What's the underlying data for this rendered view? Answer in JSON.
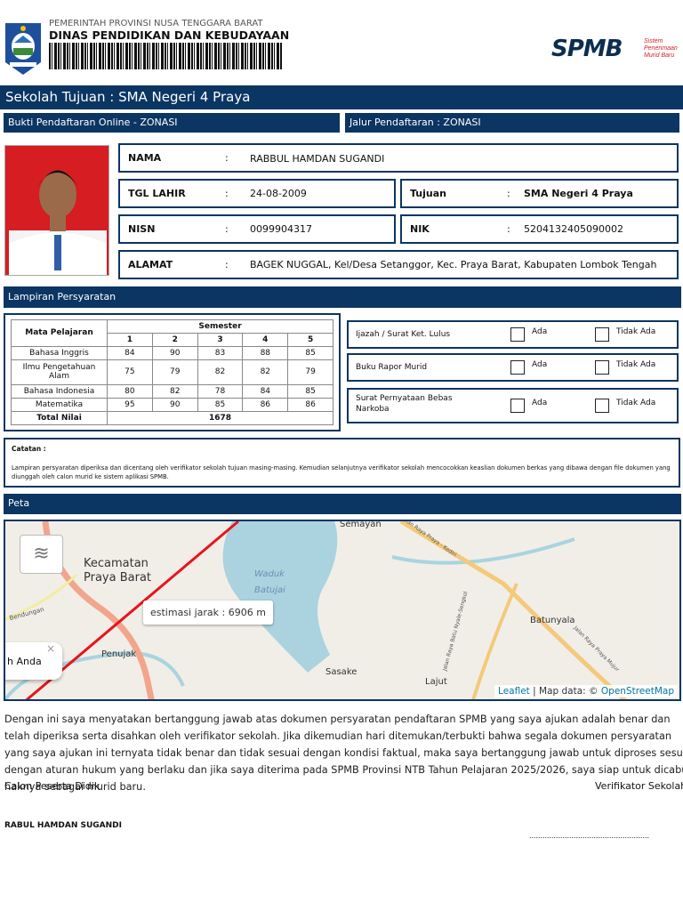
{
  "header": {
    "gov": "PEMERINTAH PROVINSI NUSA TENGGARA BARAT",
    "dept": "DINAS PENDIDIKAN DAN KEBUDAYAAN",
    "logo_text": "SPMB",
    "logo_sub": [
      "Sistem",
      "Penerimaan",
      "Murid Baru"
    ]
  },
  "title": "Sekolah Tujuan : SMA Negeri 4 Praya",
  "subbar": {
    "left": "Bukti Pendaftaran Online - ZONASI",
    "right": "Jalur Pendaftaran : ZONASI"
  },
  "info": {
    "nama": {
      "label": "NAMA",
      "value": "RABBUL HAMDAN SUGANDI"
    },
    "tgl": {
      "label": "TGL LAHIR",
      "value": "24-08-2009"
    },
    "tujuan": {
      "label": "Tujuan",
      "value": "SMA Negeri 4 Praya"
    },
    "nisn": {
      "label": "NISN",
      "value": "0099904317"
    },
    "nik": {
      "label": "NIK",
      "value": "5204132405090002"
    },
    "alamat": {
      "label": "ALAMAT",
      "value": "BAGEK NUGGAL, Kel/Desa Setanggor, Kec. Praya Barat, Kabupaten Lombok Tengah"
    },
    "colon": ":"
  },
  "lampiran": {
    "title": "Lampiran Persyaratan",
    "table": {
      "subject_header": "Mata Pelajaran",
      "semester_header": "Semester",
      "semesters": [
        "1",
        "2",
        "3",
        "4",
        "5"
      ],
      "rows": [
        {
          "subject": "Bahasa Inggris",
          "scores": [
            "84",
            "90",
            "83",
            "88",
            "85"
          ]
        },
        {
          "subject": "Ilmu Pengetahuan Alam",
          "scores": [
            "75",
            "79",
            "82",
            "82",
            "79"
          ]
        },
        {
          "subject": "Bahasa Indonesia",
          "scores": [
            "80",
            "82",
            "78",
            "84",
            "85"
          ]
        },
        {
          "subject": "Matematika",
          "scores": [
            "95",
            "90",
            "85",
            "86",
            "86"
          ]
        }
      ],
      "total_label": "Total Nilai",
      "total": "1678"
    },
    "checks": [
      {
        "label": "Ijazah / Surat Ket. Lulus"
      },
      {
        "label": "Buku Rapor Murid"
      },
      {
        "label": "Surat Pernyataan Bebas Narkoba"
      }
    ],
    "ada": "Ada",
    "tidak_ada": "Tidak Ada"
  },
  "catatan": {
    "title": "Catatan :",
    "text": "Lampiran persyaratan diperiksa dan dicentang oleh verifikator sekolah tujuan masing-masing. Kemudian selanjutnya verifikator sekolah mencocokkan keaslian dokumen berkas yang dibawa dengan file dokumen yang diunggah oleh calon murid ke sistem aplikasi SPMB."
  },
  "peta": {
    "title": "Peta",
    "labels": {
      "kecamatan": "Kecamatan",
      "praya_barat": "Praya Barat",
      "waduk": "Waduk",
      "batujai": "Batujai",
      "semayan": "Semayan",
      "penujak": "Penujak",
      "sasake": "Sasake",
      "lajut": "Lajut",
      "batunyala": "Batunyala",
      "bendungan": "Bendungan",
      "road1": "Jalan Raya Praya - Kediri",
      "road2": "Jalan Raya Batu Nyale-Sengkol",
      "road3": "Jalan Raya Praya Mujur"
    },
    "tooltip": "estimasi jarak : 6906 m",
    "popup": "h Anda",
    "popup_close": "×",
    "attr_leaflet": "Leaflet",
    "attr_sep": " | Map data: © ",
    "attr_osm": "OpenStreetMap"
  },
  "statement": "Dengan ini saya menyatakan bertanggung jawab atas dokumen persyaratan pendaftaran SPMB yang saya ajukan adalah benar dan telah diperiksa serta disahkan oleh verifikator sekolah. Jika dikemudian hari ditemukan/terbukti bahwa segala dokumen persyaratan yang saya ajukan ini ternyata tidak benar dan tidak sesuai dengan kondisi faktual, maka saya bertanggung jawab untuk diproses sesuai dengan aturan hukum yang berlaku dan jika saya diterima pada SPMB Provinsi NTB Tahun Pelajaran 2025/2026, saya siap untuk dicabut haknya sebagai murid baru.",
  "sign": {
    "left": "Calon Peserta Didik",
    "right": "Verifikator Sekolah",
    "name": "RABUL HAMDAN SUGANDI",
    "dots": "......................................................"
  }
}
